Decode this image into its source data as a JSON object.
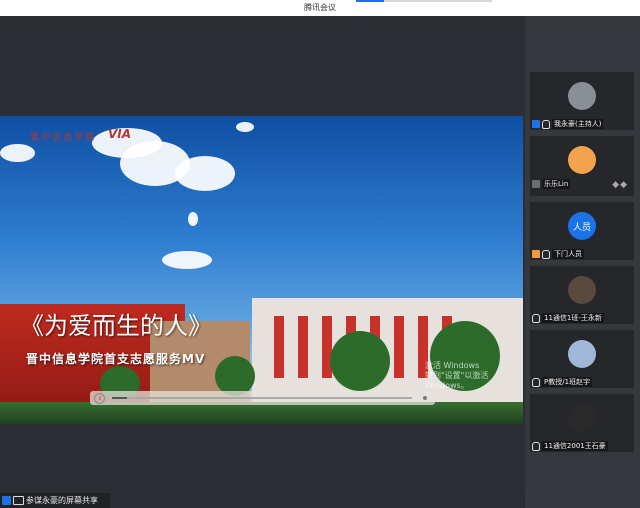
{
  "app": {
    "title": "腾讯会议"
  },
  "colors": {
    "accent": "#1a73e8",
    "main_bg": "#2b2e33",
    "panel_bg": "#35383d"
  },
  "shared_screen": {
    "logo_text": "晋中信息学院",
    "logo_mark": "VIA",
    "mv_title": "《为爱而生的人》",
    "mv_subtitle": "晋中信息学院首支志愿服务MV",
    "playback_progress": 0.05,
    "watermark_line1": "激活 Windows",
    "watermark_line2": "转到\"设置\"以激活 Windows。"
  },
  "footer": {
    "share_label": "参谋永豪的屏幕共享"
  },
  "participants": [
    {
      "name": "我永豪(主持人)",
      "avatar_icon": "photo-avatar-icon",
      "avatar_color": "#8a8f96"
    },
    {
      "name": "乐乐Lin",
      "avatar_icon": "cartoon-avatar-icon",
      "avatar_color": "#f2a34b"
    },
    {
      "name": "下门人员",
      "avatar_icon": "text-avatar-icon",
      "avatar_color": "#1a73e8",
      "avatar_text": "人员"
    },
    {
      "name": "11通信1班-王永新",
      "avatar_icon": "photo-avatar-icon",
      "avatar_color": "#5a4a3c"
    },
    {
      "name": "P教授/1班赵宇",
      "avatar_icon": "photo-avatar-icon",
      "avatar_color": "#9fb8d8"
    },
    {
      "name": "11通信2001王石豪",
      "avatar_icon": "photo-avatar-icon",
      "avatar_color": "#2a2a2a"
    }
  ]
}
